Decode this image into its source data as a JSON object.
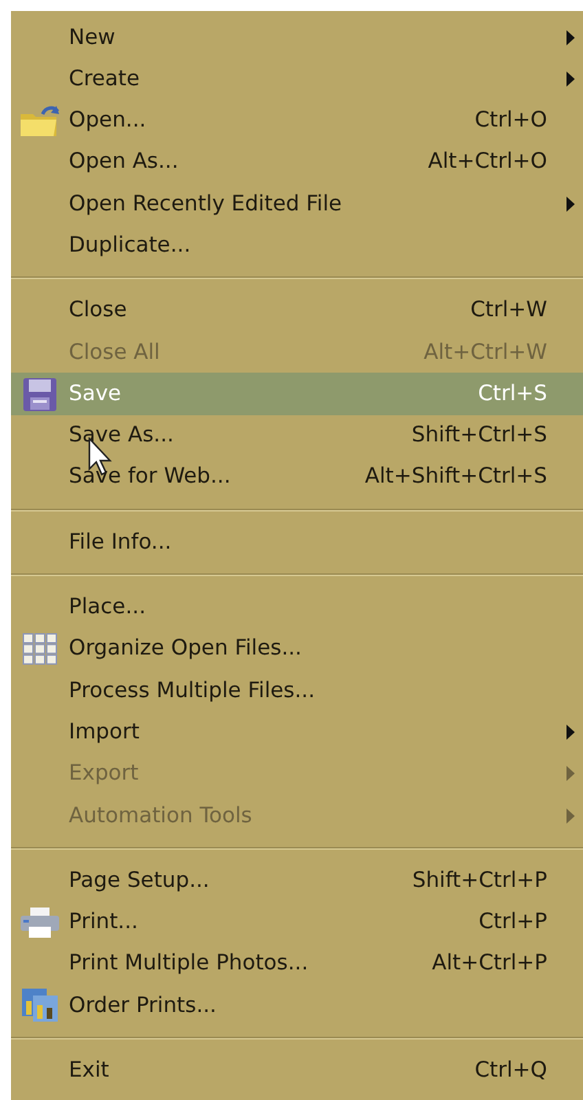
{
  "menu": {
    "groups": [
      {
        "items": [
          {
            "label": "New",
            "has_submenu": true,
            "disabled": false,
            "selected": false
          },
          {
            "label": "Create",
            "has_submenu": true,
            "disabled": false,
            "selected": false
          },
          {
            "label": "Open...",
            "shortcut": "Ctrl+O",
            "has_submenu": false,
            "disabled": false,
            "selected": false
          },
          {
            "label": "Open As...",
            "shortcut": "Alt+Ctrl+O",
            "has_submenu": false,
            "disabled": false,
            "selected": false
          },
          {
            "label": "Open Recently Edited File",
            "has_submenu": true,
            "disabled": false,
            "selected": false
          },
          {
            "label": "Duplicate...",
            "has_submenu": false,
            "disabled": false,
            "selected": false
          }
        ]
      },
      {
        "items": [
          {
            "label": "Close",
            "shortcut": "Ctrl+W",
            "has_submenu": false,
            "disabled": false,
            "selected": false
          },
          {
            "label": "Close All",
            "shortcut": "Alt+Ctrl+W",
            "has_submenu": false,
            "disabled": true,
            "selected": false
          },
          {
            "label": "Save",
            "shortcut": "Ctrl+S",
            "has_submenu": false,
            "disabled": false,
            "selected": true
          },
          {
            "label": "Save As...",
            "shortcut": "Shift+Ctrl+S",
            "has_submenu": false,
            "disabled": false,
            "selected": false
          },
          {
            "label": "Save for Web...",
            "shortcut": "Alt+Shift+Ctrl+S",
            "has_submenu": false,
            "disabled": false,
            "selected": false
          }
        ]
      },
      {
        "items": [
          {
            "label": "File Info...",
            "has_submenu": false,
            "disabled": false,
            "selected": false
          }
        ]
      },
      {
        "items": [
          {
            "label": "Place...",
            "has_submenu": false,
            "disabled": false,
            "selected": false
          },
          {
            "label": "Organize Open Files...",
            "has_submenu": false,
            "disabled": false,
            "selected": false
          },
          {
            "label": "Process Multiple Files...",
            "has_submenu": false,
            "disabled": false,
            "selected": false
          },
          {
            "label": "Import",
            "has_submenu": true,
            "disabled": false,
            "selected": false
          },
          {
            "label": "Export",
            "has_submenu": true,
            "disabled": true,
            "selected": false
          },
          {
            "label": "Automation Tools",
            "has_submenu": true,
            "disabled": true,
            "selected": false
          }
        ]
      },
      {
        "items": [
          {
            "label": "Page Setup...",
            "shortcut": "Shift+Ctrl+P",
            "has_submenu": false,
            "disabled": false,
            "selected": false
          },
          {
            "label": "Print...",
            "shortcut": "Ctrl+P",
            "has_submenu": false,
            "disabled": false,
            "selected": false
          },
          {
            "label": "Print Multiple Photos...",
            "shortcut": "Alt+Ctrl+P",
            "has_submenu": false,
            "disabled": false,
            "selected": false
          },
          {
            "label": "Order Prints...",
            "has_submenu": false,
            "disabled": false,
            "selected": false
          }
        ]
      },
      {
        "items": [
          {
            "label": "Exit",
            "shortcut": "Ctrl+Q",
            "has_submenu": false,
            "disabled": false,
            "selected": false
          }
        ]
      }
    ]
  }
}
